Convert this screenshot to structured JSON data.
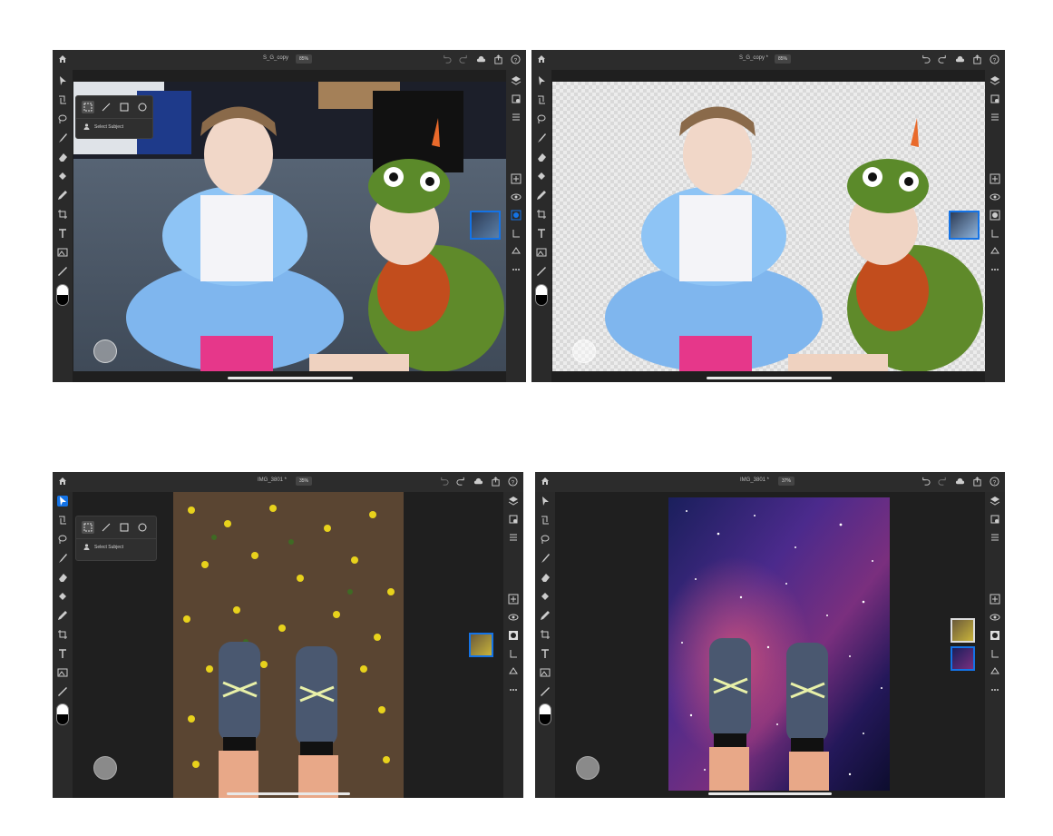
{
  "panels": [
    {
      "doc_title": "S_G_copy",
      "zoom": "85%"
    },
    {
      "doc_title": "S_G_copy *",
      "zoom": "85%"
    },
    {
      "doc_title": "IMG_3801 *",
      "zoom": "35%"
    },
    {
      "doc_title": "IMG_3801 *",
      "zoom": "37%"
    }
  ],
  "selection_popover": {
    "label": "Select Subject"
  },
  "icons": {
    "home": "home-icon",
    "undo": "undo-icon",
    "redo": "redo-icon",
    "cloud": "cloud-icon",
    "share": "share-icon",
    "help": "help-icon"
  },
  "colors": {
    "accent": "#1473e6",
    "chrome": "#2c2c2c",
    "canvas_bg": "#1f1f1f"
  }
}
